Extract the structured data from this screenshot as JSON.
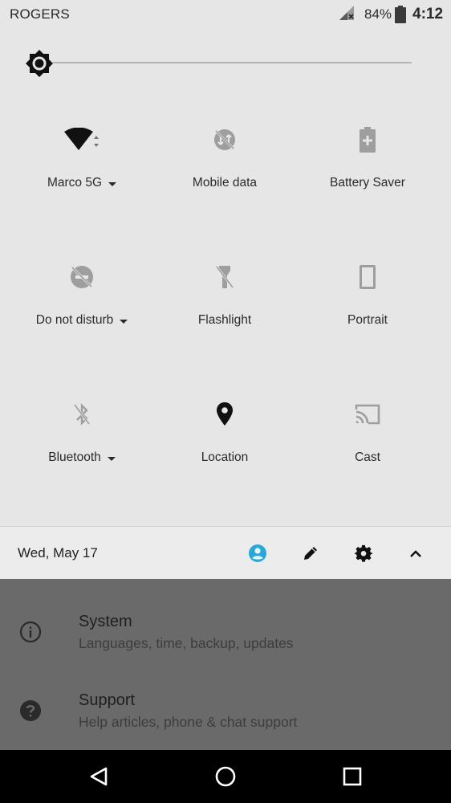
{
  "status_bar": {
    "carrier": "ROGERS",
    "battery_percent": "84%",
    "time": "4:12",
    "icons": [
      "signal-off-icon",
      "battery-icon"
    ]
  },
  "brightness": {
    "icon": "brightness-icon",
    "level": 0.0
  },
  "tiles": [
    {
      "label": "Marco 5G",
      "icon": "wifi-icon",
      "has_dropdown": true,
      "active": true
    },
    {
      "label": "Mobile data",
      "icon": "mobile-data-off-icon",
      "has_dropdown": false,
      "active": false
    },
    {
      "label": "Battery Saver",
      "icon": "battery-saver-icon",
      "has_dropdown": false,
      "active": false
    },
    {
      "label": "Do not disturb",
      "icon": "do-not-disturb-icon",
      "has_dropdown": true,
      "active": false
    },
    {
      "label": "Flashlight",
      "icon": "flashlight-off-icon",
      "has_dropdown": false,
      "active": false
    },
    {
      "label": "Portrait",
      "icon": "portrait-icon",
      "has_dropdown": false,
      "active": false
    },
    {
      "label": "Bluetooth",
      "icon": "bluetooth-off-icon",
      "has_dropdown": true,
      "active": false
    },
    {
      "label": "Location",
      "icon": "location-icon",
      "has_dropdown": false,
      "active": true
    },
    {
      "label": "Cast",
      "icon": "cast-icon",
      "has_dropdown": false,
      "active": false
    }
  ],
  "footer": {
    "date": "Wed, May 17",
    "buttons": [
      "user-icon",
      "edit-icon",
      "settings-icon",
      "collapse-icon"
    ],
    "user_color": "#29a8d8"
  },
  "settings_behind": [
    {
      "title": "System",
      "subtitle": "Languages, time, backup, updates",
      "icon": "info-icon"
    },
    {
      "title": "Support",
      "subtitle": "Help articles, phone & chat support",
      "icon": "help-icon"
    }
  ],
  "nav": {
    "buttons": [
      "back-icon",
      "home-icon",
      "recents-icon"
    ]
  }
}
